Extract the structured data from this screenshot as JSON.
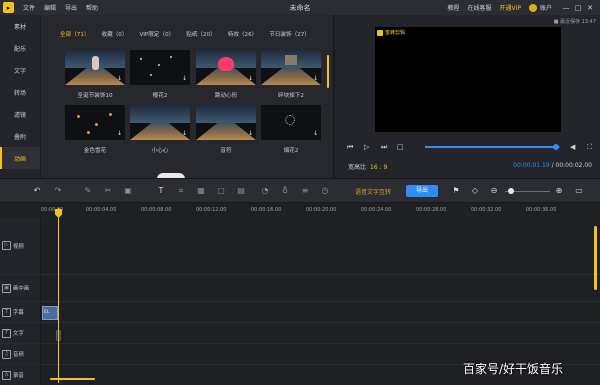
{
  "app": {
    "logo_char": "▸",
    "menu": [
      "文件",
      "编辑",
      "导出",
      "帮助"
    ],
    "title": "未命名",
    "right": {
      "tutorial": "教程",
      "online": "在线客服",
      "vip": "开通VIP",
      "account": "账户"
    },
    "window_buttons": [
      "—",
      "□",
      "✕"
    ]
  },
  "sidebar": {
    "items": [
      {
        "label": "素材",
        "active": false
      },
      {
        "label": "配乐",
        "active": false
      },
      {
        "label": "文字",
        "active": false
      },
      {
        "label": "转场",
        "active": false
      },
      {
        "label": "滤镜",
        "active": false
      },
      {
        "label": "叠附",
        "active": false
      },
      {
        "label": "动画",
        "active": true
      }
    ]
  },
  "library": {
    "tabs": [
      {
        "label": "全部（71）",
        "active": true
      },
      {
        "label": "收藏（0）",
        "active": false
      },
      {
        "label": "VIP限定（0）",
        "active": false
      },
      {
        "label": "贴纸（20）",
        "active": false
      },
      {
        "label": "特效（26）",
        "active": false
      },
      {
        "label": "节日装饰（27）",
        "active": false
      }
    ],
    "items": [
      {
        "caption": "圣诞节装饰10",
        "scene": "child"
      },
      {
        "caption": "樱花2",
        "scene": "dots"
      },
      {
        "caption": "跳动心形",
        "scene": "heart"
      },
      {
        "caption": "碎块掉下2",
        "scene": "blocks"
      },
      {
        "caption": "金色雪花",
        "scene": "gold"
      },
      {
        "caption": "小心心",
        "scene": "road"
      },
      {
        "caption": "音符",
        "scene": "road"
      },
      {
        "caption": "烟花2",
        "scene": "spark"
      }
    ]
  },
  "preview": {
    "clock": "■ 最近保存 13:47",
    "watermark": "蜜蜂剪辑",
    "ratio_label": "宽高比",
    "ratio_value": "16 : 9",
    "current_time": "00:00:01.19",
    "total_time": "00:00:02.00",
    "progress": 0.97,
    "controls": {
      "prev": "⏮",
      "play": "▷",
      "next": "⏭",
      "stop": "□",
      "volume": "◀",
      "fullscreen": "⛶"
    }
  },
  "toolbar": {
    "voice_to_text": "语音文字互转",
    "export": "导出",
    "zoom_level": 0.1
  },
  "timeline": {
    "ruler": [
      "00:00.00",
      "00:00:04.00",
      "00:00:08.00",
      "00:00:12.00",
      "00:00:16.00",
      "00:00:20.00",
      "00:00:24.00",
      "00:00:28.00",
      "00:00:32.00",
      "00:00:36.00"
    ],
    "tracks": [
      {
        "label": "视频",
        "icon": "video-icon"
      },
      {
        "label": "画中画",
        "icon": "pip-icon"
      },
      {
        "label": "字幕",
        "icon": "subtitle-icon"
      },
      {
        "label": "文字",
        "icon": "text-icon"
      },
      {
        "label": "音频",
        "icon": "music-icon"
      },
      {
        "label": "录音",
        "icon": "mic-icon"
      }
    ],
    "subtitle_clip_label": "EL"
  },
  "overlay": {
    "text": "百家号/好干饭音乐"
  },
  "colors": {
    "accent": "#f4c21c",
    "primary": "#2f8ef4",
    "bg": "#1b1c20"
  }
}
